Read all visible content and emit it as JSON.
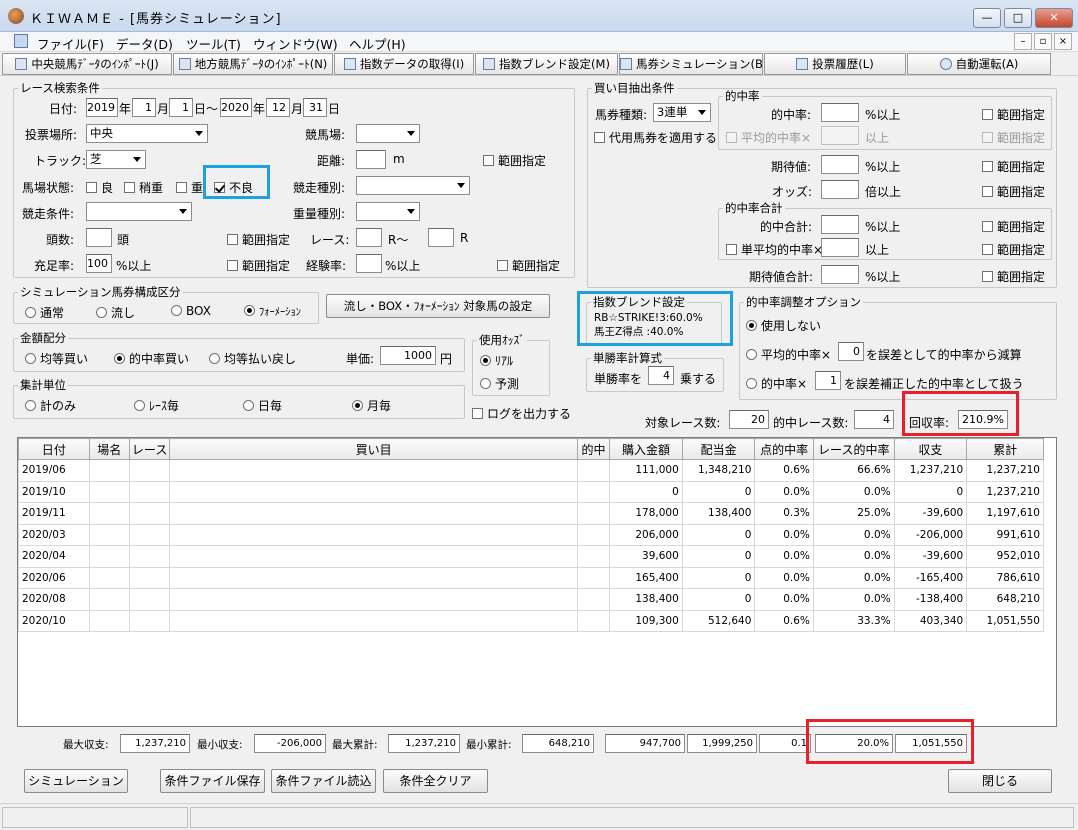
{
  "window": {
    "title": "ＫＩＷＡＭＥ - [馬券シミュレーション]"
  },
  "menu": [
    "ファイル(F)",
    "データ(D)",
    "ツール(T)",
    "ウィンドウ(W)",
    "ヘルプ(H)"
  ],
  "toolbar": [
    "中央競馬ﾃﾞｰﾀのｲﾝﾎﾟｰﾄ(J)",
    "地方競馬ﾃﾞｰﾀのｲﾝﾎﾟｰﾄ(N)",
    "指数データの取得(I)",
    "指数ブレンド設定(M)",
    "馬券シミュレーション(B)",
    "投票履歴(L)",
    "自動運転(A)"
  ],
  "race": {
    "legend": "レース検索条件",
    "date_label": "日付:",
    "y1": "2019",
    "m1": "1",
    "d1": "1",
    "y2": "2020",
    "m2": "12",
    "d2": "31",
    "u_year": "年",
    "u_month": "月",
    "u_day_sep": "日～",
    "u_day": "日",
    "venue_label": "投票場所:",
    "venue_value": "中央",
    "track_label": "競馬場:",
    "surface_label": "トラック:",
    "surface_value": "芝",
    "distance_label": "距離:",
    "distance_unit": "m",
    "range": "範囲指定",
    "going_label": "馬場状態:",
    "going": [
      "良",
      "稍重",
      "重",
      "不良"
    ],
    "racetype_label": "競走種別:",
    "cond_label": "競走条件:",
    "weight_label": "重量種別:",
    "heads_label": "頭数:",
    "heads_unit": "頭",
    "raceno_label": "レース:",
    "raceno_from": "R～",
    "raceno_to": "R",
    "fill_label": "充足率:",
    "fill_value": "100",
    "fill_unit": "%以上",
    "exp_label": "経験率:",
    "exp_unit": "%以上"
  },
  "bet": {
    "legend": "買い目抽出条件",
    "type_label": "馬券種類:",
    "type_value": "3連単",
    "alt_label": "代用馬券を適用する",
    "hit_legend": "的中率",
    "hit_label": "的中率:",
    "pct_over": "%以上",
    "avg_hit_label": "平均的中率×",
    "over": "以上",
    "ev_label": "期待値:",
    "odds_label": "オッズ:",
    "odds_unit": "倍以上",
    "total_legend": "的中率合計",
    "hit_total_label": "的中合計:",
    "single_avg_label": "単平均的中率×",
    "ev_total_label": "期待値合計:",
    "range": "範囲指定"
  },
  "sim": {
    "legend": "シミュレーション馬券構成区分",
    "options": [
      "通常",
      "流し",
      "BOX",
      "ﾌｫｰﾒｰｼｮﾝ"
    ],
    "selected": 3,
    "set_button": "流し・BOX・ﾌｫｰﾒｰｼｮﾝ 対象馬の設定"
  },
  "blend": {
    "legend": "指数ブレンド設定",
    "line1": "RB☆STRIKE!3:60.0%",
    "line2": "馬王Z得点 :40.0%"
  },
  "adjust": {
    "legend": "的中率調整オプション",
    "opt0": "使用しない",
    "opt1_pre": "平均的中率×",
    "opt1_val": "0",
    "opt1_post": "を誤差として的中率から減算",
    "opt2_pre": "的中率×",
    "opt2_val": "1",
    "opt2_post": "を誤差補正した的中率として扱う"
  },
  "money": {
    "legend": "金額配分",
    "options": [
      "均等買い",
      "的中率買い",
      "均等払い戻し"
    ],
    "selected": 1,
    "unit_label": "単価:",
    "unit_value": "1000",
    "unit_suffix": "円"
  },
  "odds": {
    "legend": "使用ｵｯｽﾞ",
    "options": [
      "ﾘｱﾙ",
      "予測"
    ],
    "selected": 0
  },
  "winrate": {
    "legend": "単勝率計算式",
    "pre": "単勝率を",
    "val": "4",
    "post": "乗する"
  },
  "agg": {
    "legend": "集計単位",
    "options": [
      "計のみ",
      "ﾚｰｽ毎",
      "日毎",
      "月毎"
    ],
    "selected": 3
  },
  "log_label": "ログを出力する",
  "summary": {
    "races_label": "対象レース数:",
    "races": "20",
    "hits_label": "的中レース数:",
    "hits": "4",
    "recovery_label": "回収率:",
    "recovery": "210.9%"
  },
  "table": {
    "headers": [
      "日付",
      "場名",
      "レース",
      "買い目",
      "的中",
      "購入金額",
      "配当金",
      "点的中率",
      "レース的中率",
      "収支",
      "累計"
    ],
    "rows": [
      [
        "2019/06",
        "",
        "",
        "",
        "",
        "111,000",
        "1,348,210",
        "0.6%",
        "66.6%",
        "1,237,210",
        "1,237,210"
      ],
      [
        "2019/10",
        "",
        "",
        "",
        "",
        "0",
        "0",
        "0.0%",
        "0.0%",
        "0",
        "1,237,210"
      ],
      [
        "2019/11",
        "",
        "",
        "",
        "",
        "178,000",
        "138,400",
        "0.3%",
        "25.0%",
        "-39,600",
        "1,197,610"
      ],
      [
        "2020/03",
        "",
        "",
        "",
        "",
        "206,000",
        "0",
        "0.0%",
        "0.0%",
        "-206,000",
        "991,610"
      ],
      [
        "2020/04",
        "",
        "",
        "",
        "",
        "39,600",
        "0",
        "0.0%",
        "0.0%",
        "-39,600",
        "952,010"
      ],
      [
        "2020/06",
        "",
        "",
        "",
        "",
        "165,400",
        "0",
        "0.0%",
        "0.0%",
        "-165,400",
        "786,610"
      ],
      [
        "2020/08",
        "",
        "",
        "",
        "",
        "138,400",
        "0",
        "0.0%",
        "0.0%",
        "-138,400",
        "648,210"
      ],
      [
        "2020/10",
        "",
        "",
        "",
        "",
        "109,300",
        "512,640",
        "0.6%",
        "33.3%",
        "403,340",
        "1,051,550"
      ]
    ]
  },
  "footer": {
    "max_label": "最大収支:",
    "max": "1,237,210",
    "min_label": "最小収支:",
    "min": "-206,000",
    "maxcum_label": "最大累計:",
    "maxcum": "1,237,210",
    "mincum_label": "最小累計:",
    "mincum": "648,210",
    "purchase": "947,700",
    "payout": "1,999,250",
    "pointhit": "0.1",
    "racehit": "20.0%",
    "balance": "1,051,550"
  },
  "buttons": {
    "simulate": "シミュレーション",
    "save": "条件ファイル保存",
    "load": "条件ファイル読込",
    "clear": "条件全クリア",
    "close": "閉じる"
  }
}
